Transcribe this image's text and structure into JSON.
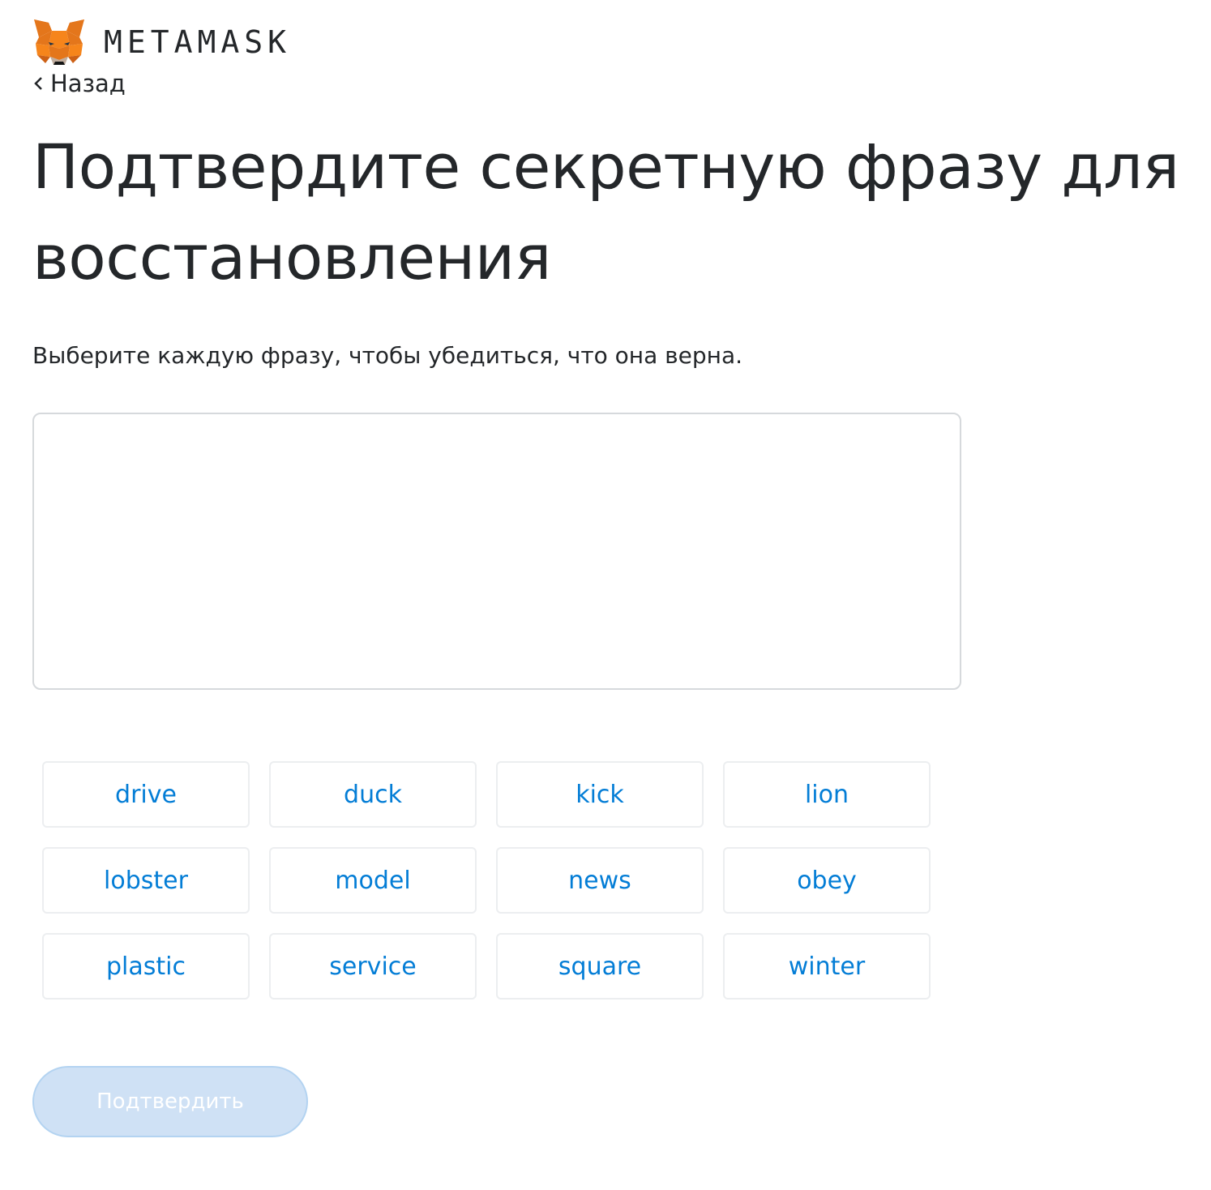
{
  "header": {
    "logo_icon": "metamask-fox-icon",
    "logo_text": "METAMASK",
    "back_label": "Назад"
  },
  "main": {
    "title": "Подтвердите секретную фразу для восстановления",
    "subtitle": "Выберите каждую фразу, чтобы убедиться, что она верна.",
    "words": [
      "drive",
      "duck",
      "kick",
      "lion",
      "lobster",
      "model",
      "news",
      "obey",
      "plastic",
      "service",
      "square",
      "winter"
    ],
    "confirm_label": "Подтвердить",
    "confirm_disabled": true
  },
  "colors": {
    "text": "#24272a",
    "accent": "#037dd6",
    "button_disabled_bg": "#cfe1f5",
    "border": "#d6d9dc"
  }
}
